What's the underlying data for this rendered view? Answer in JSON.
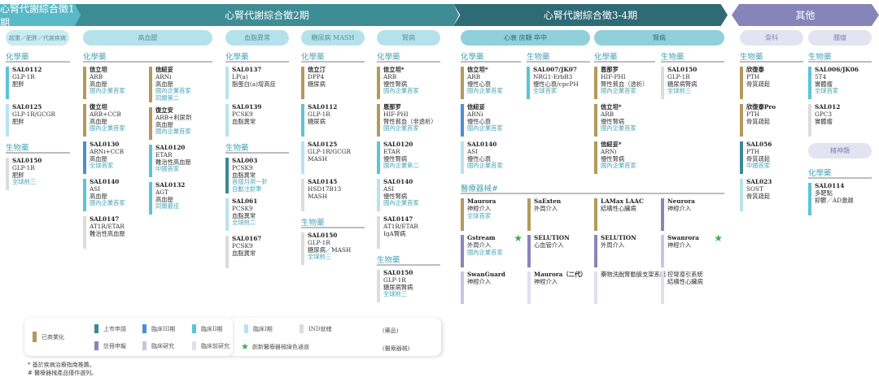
{
  "banners": [
    "心腎代謝綜合徵1期",
    "心腎代謝綜合徵2期",
    "心腎代謝綜合徵3-4期",
    "其他"
  ],
  "pills": [
    "超重／肥胖／代謝疾病",
    "高血壓",
    "血脂異常",
    "糖尿病 MASH",
    "腎病",
    "心衰 房顫 卒中",
    "腎病",
    "骨科",
    "腫瘤"
  ],
  "colors": {
    "commercial": "#b39a5a",
    "filing": "#3a8a92",
    "p3": "#4a90d0",
    "p2": "#5bc4d6",
    "p1": "#b9e3ec",
    "ind": "#dcdcdc",
    "reg": "#8a84bb",
    "clinical": "#c8c5e0",
    "preclinical": "#e0dff0",
    "star": "#3cae4c"
  },
  "columns": [
    {
      "items": [
        {
          "t": "h",
          "text": "化學藥"
        },
        {
          "t": "c",
          "p": "p2",
          "name": "SAL0112",
          "lines": [
            "GLP-1R",
            "肥胖"
          ],
          "hl": []
        },
        {
          "t": "c",
          "p": "p1",
          "name": "SAL0125",
          "lines": [
            "GLP-1R/GCGR",
            "肥胖"
          ],
          "hl": []
        },
        {
          "t": "h",
          "text": "生物藥"
        },
        {
          "t": "c",
          "p": "ind",
          "name": "SAL0150",
          "lines": [
            "GLP-1R",
            "肥胖"
          ],
          "hl": [
            "全球前三"
          ]
        }
      ]
    },
    {
      "items": [
        {
          "t": "h",
          "text": "化學藥"
        },
        {
          "t": "c",
          "p": "commercial",
          "name": "信立坦",
          "lines": [
            "ARB",
            "高血壓"
          ],
          "hl": [
            "國內企業首家"
          ]
        },
        {
          "t": "c",
          "p": "commercial",
          "name": "復立坦",
          "lines": [
            "ARB+CCB",
            "高血壓"
          ],
          "hl": [
            "國內企業首家"
          ]
        },
        {
          "t": "c",
          "p": "p3",
          "name": "SAL0130",
          "lines": [
            "ARNi+CCB",
            "高血壓"
          ],
          "hl": [
            "全球首家"
          ]
        },
        {
          "t": "c",
          "p": "p2",
          "name": "SAL0140",
          "lines": [
            "ASI",
            "高血壓"
          ],
          "hl": [
            "國內企業首家"
          ]
        },
        {
          "t": "c",
          "p": "ind",
          "name": "SAL0147",
          "lines": [
            "AT1R/ETAR",
            "難治性高血壓"
          ],
          "hl": []
        }
      ]
    },
    {
      "items": [
        {
          "t": "h",
          "text": ""
        },
        {
          "t": "c",
          "p": "commercial",
          "name": "信紐妥",
          "lines": [
            "ARNi",
            "高血壓"
          ],
          "hl": [
            "國內企業首家",
            "同類第二"
          ]
        },
        {
          "t": "c",
          "p": "commercial",
          "name": "復立安",
          "lines": [
            "ARB+利尿劑",
            "高血壓"
          ],
          "hl": [
            "國內企業首家"
          ]
        },
        {
          "t": "c",
          "p": "p2",
          "name": "SAL0120",
          "lines": [
            "ETAR",
            "難治性高血壓"
          ],
          "hl": [
            "中國首家"
          ]
        },
        {
          "t": "c",
          "p": "p2",
          "name": "SAL0132",
          "lines": [
            "AGT",
            "高血壓"
          ],
          "hl": [
            "同類最佳"
          ]
        }
      ]
    },
    {
      "items": [
        {
          "t": "h",
          "text": "化學藥"
        },
        {
          "t": "c",
          "p": "p1",
          "name": "SAL0137",
          "lines": [
            "LP(a)",
            "脂蛋白(a)增高症"
          ],
          "hl": []
        },
        {
          "t": "c",
          "p": "p1",
          "name": "SAL0139",
          "lines": [
            "PCSK9",
            "血脂異常"
          ],
          "hl": []
        },
        {
          "t": "h",
          "text": "生物藥"
        },
        {
          "t": "c",
          "p": "filing",
          "name": "SAL003",
          "lines": [
            "PCSK9",
            "血脂異常"
          ],
          "hl": [
            "首個月用一針",
            "自動注射筆"
          ]
        },
        {
          "t": "c",
          "p": "p1",
          "name": "SAL061",
          "lines": [
            "PCSK9",
            "血脂異常"
          ],
          "hl": [
            "全球前二"
          ]
        },
        {
          "t": "c",
          "p": "ind",
          "name": "SAL0167",
          "lines": [
            "PCSK9",
            "血脂異常"
          ],
          "hl": []
        }
      ]
    },
    {
      "items": [
        {
          "t": "h",
          "text": "化學藥"
        },
        {
          "t": "c",
          "p": "commercial",
          "name": "信立汀",
          "lines": [
            "DPP4",
            "糖尿病"
          ],
          "hl": []
        },
        {
          "t": "c",
          "p": "p2",
          "name": "SAL0112",
          "lines": [
            "GLP-1R",
            "糖尿病"
          ],
          "hl": []
        },
        {
          "t": "c",
          "p": "p1",
          "name": "SAL0125",
          "lines": [
            "GLP-1R/GCGR",
            "MASH"
          ],
          "hl": []
        },
        {
          "t": "c",
          "p": "ind",
          "name": "SAL0145",
          "lines": [
            "HSD17B13",
            "MASH"
          ],
          "hl": []
        },
        {
          "t": "h",
          "text": "生物藥"
        },
        {
          "t": "c",
          "p": "ind",
          "name": "SAL0150",
          "lines": [
            "GLP-1R",
            "糖尿病／MASH"
          ],
          "hl": [
            "全球前三"
          ]
        }
      ]
    },
    {
      "items": [
        {
          "t": "h",
          "text": "化學藥"
        },
        {
          "t": "c",
          "p": "commercial",
          "name": "信立坦*",
          "lines": [
            "ARB",
            "慢性腎病"
          ],
          "hl": [
            "國內企業首家"
          ]
        },
        {
          "t": "c",
          "p": "commercial",
          "name": "恩那罗",
          "lines": [
            "HIF-PHI",
            "腎性貧血（非透析）"
          ],
          "hl": [
            "國內企業首家"
          ]
        },
        {
          "t": "c",
          "p": "p2",
          "name": "SAL0120",
          "lines": [
            "ETAR",
            "慢性腎病"
          ],
          "hl": [
            "國內企業第二"
          ]
        },
        {
          "t": "c",
          "p": "p1",
          "name": "SAL0140",
          "lines": [
            "ASI",
            "慢性腎病"
          ],
          "hl": [
            "國內企業首家"
          ]
        },
        {
          "t": "c",
          "p": "ind",
          "name": "SAL0147",
          "lines": [
            "AT1R/ETAR",
            "IgA腎病"
          ],
          "hl": []
        },
        {
          "t": "h",
          "text": "生物藥"
        },
        {
          "t": "c",
          "p": "ind",
          "name": "SAL0150",
          "lines": [
            "GLP-1R",
            "糖尿病腎病"
          ],
          "hl": [
            "全球前三"
          ]
        }
      ]
    },
    {
      "items": [
        {
          "t": "h",
          "text": "化學藥"
        },
        {
          "t": "c",
          "p": "commercial",
          "name": "信立坦*",
          "lines": [
            "ARB",
            "慢性心衰"
          ],
          "hl": [
            "國內企業首家"
          ]
        },
        {
          "t": "c",
          "p": "p3",
          "name": "信紐妥",
          "lines": [
            "ARNi",
            "慢性心衰"
          ],
          "hl": [
            "國內企業首家"
          ]
        },
        {
          "t": "c",
          "p": "p1",
          "name": "SAL0140",
          "lines": [
            "ASI",
            "慢性心衰"
          ],
          "hl": [
            "國內企業首家"
          ]
        }
      ]
    },
    {
      "items": [
        {
          "t": "h",
          "text": "生物藥"
        },
        {
          "t": "c",
          "p": "p2",
          "name": "SAL007/JK07",
          "lines": [
            "NRG1-ErbB3",
            "慢性心衰/cpcPH"
          ],
          "hl": [
            "全球首家"
          ]
        }
      ]
    },
    {
      "items": [
        {
          "t": "h",
          "text": "化學藥"
        },
        {
          "t": "c",
          "p": "commercial",
          "name": "恩那罗",
          "lines": [
            "HIF-PHI",
            "腎性貧血（透析）"
          ],
          "hl": [
            "國內企業首家"
          ]
        },
        {
          "t": "c",
          "p": "commercial",
          "name": "信立坦*",
          "lines": [
            "ARB",
            "慢性腎病"
          ],
          "hl": [
            "國內企業首家"
          ]
        },
        {
          "t": "c",
          "p": "commercial",
          "name": "信紐妥*",
          "lines": [
            "ARNi",
            "慢性腎病"
          ],
          "hl": [
            "國內企業首家"
          ]
        }
      ]
    },
    {
      "items": [
        {
          "t": "h",
          "text": "生物藥"
        },
        {
          "t": "c",
          "p": "ind",
          "name": "SAL0150",
          "lines": [
            "GLP-1R",
            "糖尿病腎病"
          ],
          "hl": [
            "全球前三"
          ]
        }
      ]
    },
    {
      "items": [
        {
          "t": "h",
          "text": "生物藥"
        },
        {
          "t": "c",
          "p": "commercial",
          "name": "欣復泰",
          "lines": [
            "PTH",
            "骨質疏鬆"
          ],
          "hl": []
        },
        {
          "t": "c",
          "p": "commercial",
          "name": "欣復泰Pro",
          "lines": [
            "PTH",
            "骨質疏鬆"
          ],
          "hl": []
        },
        {
          "t": "c",
          "p": "filing",
          "name": "SAL056",
          "lines": [
            "PTH",
            "骨質疏鬆"
          ],
          "hl": [
            "中國首家"
          ]
        },
        {
          "t": "c",
          "p": "p1",
          "name": "SAL023",
          "lines": [
            "SOST",
            "骨質疏鬆"
          ],
          "hl": []
        }
      ]
    },
    {
      "items": [
        {
          "t": "h",
          "text": "生物藥"
        },
        {
          "t": "c",
          "p": "p2",
          "name": "SAL006/JK06",
          "lines": [
            "5T4",
            "實體瘤"
          ],
          "hl": [
            "全球首家"
          ]
        },
        {
          "t": "c",
          "p": "ind",
          "name": "SAL012",
          "lines": [
            "GPC3",
            "實體瘤"
          ],
          "hl": []
        },
        {
          "t": "pill",
          "text": "精神類"
        },
        {
          "t": "h",
          "text": "化學藥"
        },
        {
          "t": "c",
          "p": "p2",
          "name": "SAL0114",
          "lines": [
            "多靶點",
            "抑鬱／AD激越"
          ],
          "hl": []
        }
      ]
    }
  ],
  "devices": {
    "title": "醫療器械#",
    "items": [
      {
        "p": "commercial",
        "name": "Maurora",
        "lines": [
          "神經介入"
        ],
        "hl": [
          "全球首家"
        ]
      },
      {
        "p": "commercial",
        "name": "SaExten",
        "lines": [
          "外周介入"
        ],
        "hl": []
      },
      {
        "p": "commercial",
        "name": "LAMax LAAC",
        "lines": [
          "結構性心臟病"
        ],
        "hl": []
      },
      {
        "p": "reg",
        "name": "Neurora",
        "lines": [
          "神經介入"
        ],
        "hl": []
      },
      {
        "p": "reg",
        "name": "Gstream",
        "lines": [
          "外周介入"
        ],
        "hl": [
          "國內企業首家"
        ],
        "star": true
      },
      {
        "p": "reg",
        "name": "SELUTION",
        "lines": [
          "心血管介入"
        ],
        "hl": []
      },
      {
        "p": "reg",
        "name": "SELUTION",
        "lines": [
          "外周介入"
        ],
        "hl": []
      },
      {
        "p": "clinical",
        "name": "Swanrora",
        "lines": [
          "神經介入"
        ],
        "hl": [],
        "star": true
      },
      {
        "p": "clinical",
        "name": "SwanGuard",
        "lines": [
          "神經介入"
        ],
        "hl": []
      },
      {
        "p": "preclinical",
        "name": "Maurora（二代）",
        "lines": [
          "神經介入"
        ],
        "hl": []
      },
      {
        "p": "preclinical",
        "name": "藥物洗脫腎動脈支架系統",
        "plain": true,
        "lines": [],
        "hl": []
      },
      {
        "p": "preclinical",
        "name": "控彎導引系統",
        "plain": true,
        "lines": [
          "結構性心臟病"
        ],
        "hl": []
      }
    ]
  },
  "legend": {
    "commercial": "已商業化",
    "filing": "上市申請",
    "p3": "臨床III期",
    "p2": "臨床II期",
    "p1": "臨床I期",
    "ind": "IND就緒",
    "reg": "註冊申報",
    "clinical": "臨床研究",
    "preclinical": "臨床前研究",
    "star": "創新醫療器械綠色通道",
    "drugs": "(藥品)",
    "device": "(醫療器械)"
  },
  "footnotes": [
    "* 基於疾病治療指南推薦。",
    "# 醫療器械產品僅作選列。"
  ]
}
